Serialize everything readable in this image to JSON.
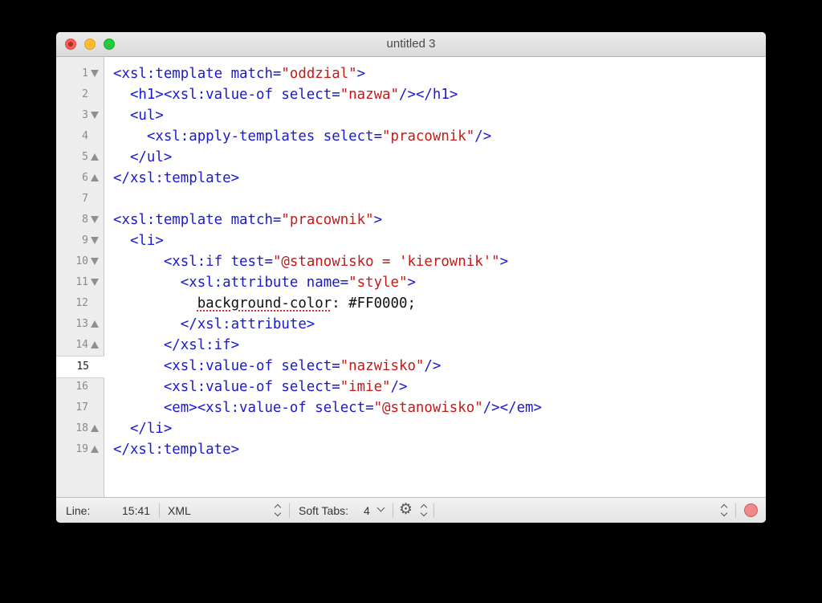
{
  "window": {
    "title": "untitled 3"
  },
  "gutter": {
    "current_line": "15",
    "lines": [
      {
        "num": "1",
        "fold": "down"
      },
      {
        "num": "2",
        "fold": ""
      },
      {
        "num": "3",
        "fold": "down"
      },
      {
        "num": "4",
        "fold": ""
      },
      {
        "num": "5",
        "fold": "up"
      },
      {
        "num": "6",
        "fold": "up"
      },
      {
        "num": "7",
        "fold": ""
      },
      {
        "num": "8",
        "fold": "down"
      },
      {
        "num": "9",
        "fold": "down"
      },
      {
        "num": "10",
        "fold": "down"
      },
      {
        "num": "11",
        "fold": "down"
      },
      {
        "num": "12",
        "fold": ""
      },
      {
        "num": "13",
        "fold": "up"
      },
      {
        "num": "14",
        "fold": "up"
      },
      {
        "num": "15",
        "fold": ""
      },
      {
        "num": "16",
        "fold": ""
      },
      {
        "num": "17",
        "fold": ""
      },
      {
        "num": "18",
        "fold": "up"
      },
      {
        "num": "19",
        "fold": "up"
      }
    ]
  },
  "code": {
    "lines": [
      [
        [
          "tag",
          "<xsl:template match="
        ],
        [
          "str",
          "\"oddzial\""
        ],
        [
          "tag",
          ">"
        ]
      ],
      [
        [
          "tag",
          "  <h1><xsl:value-of select="
        ],
        [
          "str",
          "\"nazwa\""
        ],
        [
          "tag",
          "/></h1>"
        ]
      ],
      [
        [
          "tag",
          "  <ul>"
        ]
      ],
      [
        [
          "tag",
          "    <xsl:apply-templates select="
        ],
        [
          "str",
          "\"pracownik\""
        ],
        [
          "tag",
          "/>"
        ]
      ],
      [
        [
          "tag",
          "  </ul>"
        ]
      ],
      [
        [
          "tag",
          "</xsl:template>"
        ]
      ],
      [],
      [
        [
          "tag",
          "<xsl:template match="
        ],
        [
          "str",
          "\"pracownik\""
        ],
        [
          "tag",
          ">"
        ]
      ],
      [
        [
          "tag",
          "  <li>"
        ]
      ],
      [
        [
          "tag",
          "      <xsl:if test="
        ],
        [
          "str",
          "\"@stanowisko = 'kierownik'\""
        ],
        [
          "tag",
          ">"
        ]
      ],
      [
        [
          "tag",
          "        <xsl:attribute name="
        ],
        [
          "str",
          "\"style\""
        ],
        [
          "tag",
          ">"
        ]
      ],
      [
        [
          "txt",
          "          "
        ],
        [
          "spell",
          "background-color"
        ],
        [
          "txt",
          ": #FF0000;"
        ]
      ],
      [
        [
          "tag",
          "        </xsl:attribute>"
        ]
      ],
      [
        [
          "tag",
          "      </xsl:if>"
        ]
      ],
      [
        [
          "tag",
          "      <xsl:value-of select="
        ],
        [
          "str",
          "\"nazwisko\""
        ],
        [
          "tag",
          "/>"
        ]
      ],
      [
        [
          "tag",
          "      <xsl:value-of select="
        ],
        [
          "str",
          "\"imie\""
        ],
        [
          "tag",
          "/>"
        ]
      ],
      [
        [
          "tag",
          "      <em><xsl:value-of select="
        ],
        [
          "str",
          "\"@stanowisko\""
        ],
        [
          "tag",
          "/></em>"
        ]
      ],
      [
        [
          "tag",
          "  </li>"
        ]
      ],
      [
        [
          "tag",
          "</xsl:template>"
        ]
      ]
    ]
  },
  "statusbar": {
    "line_label": "Line:",
    "position": "15:41",
    "language": "XML",
    "soft_tabs_label": "Soft Tabs:",
    "tab_size": "4",
    "icons": {
      "settings": "gear-icon",
      "record": "record-macro-icon"
    }
  },
  "colors": {
    "tag": "#1a1acd",
    "string": "#c41a16",
    "text": "#111111",
    "gutter_bg": "#ededed"
  }
}
